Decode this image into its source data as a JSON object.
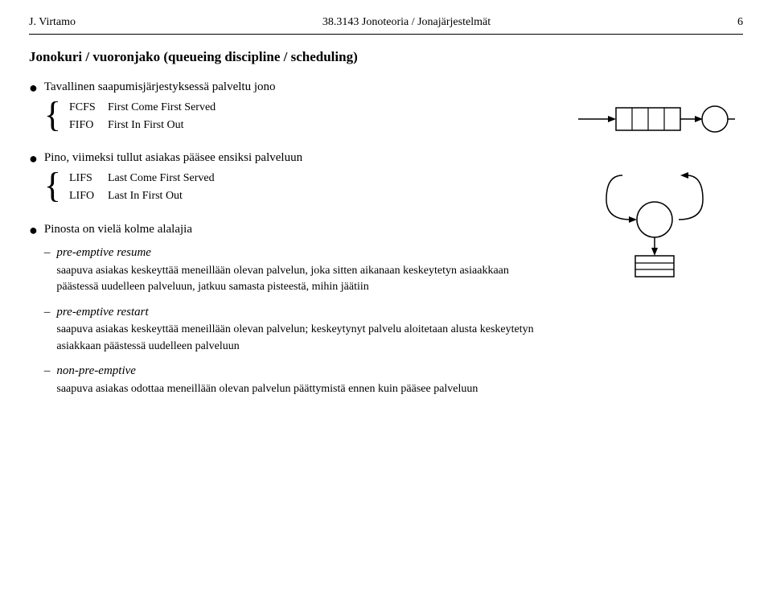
{
  "header": {
    "left": "J. Virtamo",
    "center": "38.3143 Jonoteoria / Jonajärjestelmät",
    "right": "6"
  },
  "title": "Jonokuri / vuoronjako (queueing discipline / scheduling)",
  "section1": {
    "bullet": "●",
    "label": "Tavallinen saapumisjärjestyksessä palveltu jono",
    "brace_rows": [
      {
        "key": "FCFS",
        "val": "First Come First Served"
      },
      {
        "key": "FIFO",
        "val": "First In First Out"
      }
    ]
  },
  "section2": {
    "bullet": "●",
    "label": "Pino, viimeksi tullut asiakas pääsee ensiksi palveluun",
    "brace_rows": [
      {
        "key": "LIFS",
        "val": "Last Come First Served"
      },
      {
        "key": "LIFO",
        "val": "Last In First Out"
      }
    ]
  },
  "section3": {
    "bullet": "●",
    "label": "Pinosta on vielä kolme alalajia",
    "dash_items": [
      {
        "title": "pre-emptive resume",
        "text": "saapuva asiakas keskeyttää meneillään olevan palvelun, joka sitten aikanaan keskeytetyn asiaakkaan päästessä uudelleen palveluun, jatkuu samasta pisteestä, mihin jäätiin"
      },
      {
        "title": "pre-emptive restart",
        "text": "saapuva asiakas keskeyttää meneillään olevan palvelun; keskeytynyt palvelu aloitetaan alusta keskeytetyn asiakkaan päästessä uudelleen palveluun"
      },
      {
        "title": "non-pre-emptive",
        "text": "saapuva asiakas odottaa meneillään olevan palvelun päättymistä ennen kuin pääsee palveluun"
      }
    ]
  }
}
